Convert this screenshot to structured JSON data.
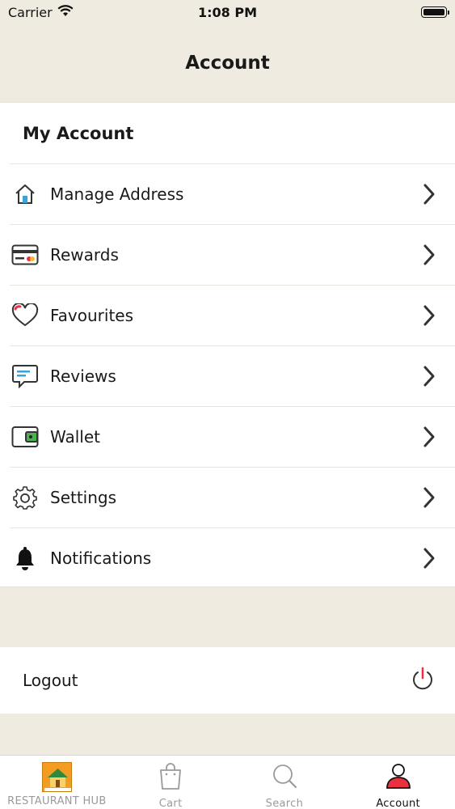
{
  "status": {
    "carrier": "Carrier",
    "time": "1:08 PM"
  },
  "nav": {
    "title": "Account"
  },
  "section": {
    "title": "My Account"
  },
  "menu": [
    {
      "label": "Manage Address",
      "icon": "house-icon"
    },
    {
      "label": "Rewards",
      "icon": "card-icon"
    },
    {
      "label": "Favourites",
      "icon": "heart-icon"
    },
    {
      "label": "Reviews",
      "icon": "chat-bubble-icon"
    },
    {
      "label": "Wallet",
      "icon": "wallet-icon"
    },
    {
      "label": "Settings",
      "icon": "gear-icon"
    },
    {
      "label": "Notifications",
      "icon": "bell-icon"
    }
  ],
  "logout": {
    "label": "Logout",
    "icon": "power-icon"
  },
  "tabs": [
    {
      "label": "RESTAURANT HUB",
      "icon": "restaurant-logo-icon"
    },
    {
      "label": "Cart",
      "icon": "shopping-bag-icon"
    },
    {
      "label": "Search",
      "icon": "search-icon"
    },
    {
      "label": "Account",
      "icon": "user-icon",
      "active": true
    }
  ],
  "colors": {
    "background": "#f0ebe0",
    "accent": "#e8303e",
    "text": "#1a1a1a",
    "inactive": "#9a9a9a"
  }
}
